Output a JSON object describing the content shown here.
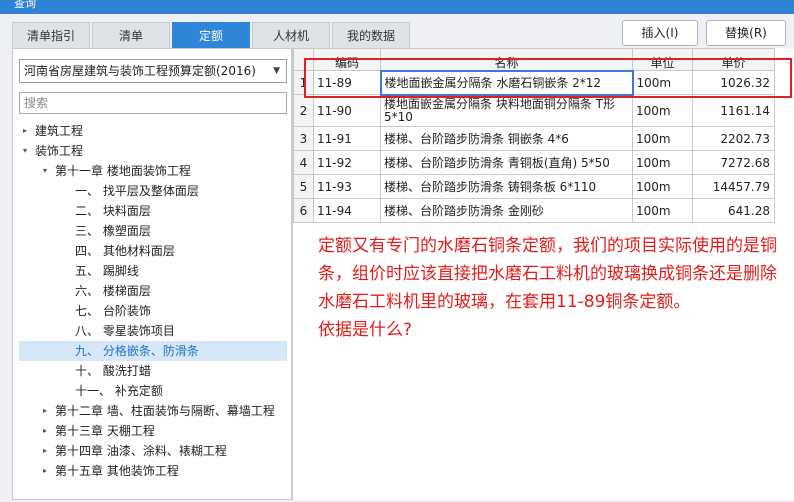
{
  "window": {
    "title": "查询"
  },
  "tabs": [
    {
      "label": "清单指引",
      "active": false
    },
    {
      "label": "清单",
      "active": false
    },
    {
      "label": "定额",
      "active": true
    },
    {
      "label": "人材机",
      "active": false
    },
    {
      "label": "我的数据",
      "active": false
    }
  ],
  "buttons": {
    "insert": "插入(I)",
    "replace": "替换(R)"
  },
  "left": {
    "dropdown_value": "河南省房屋建筑与装饰工程预算定额(2016)",
    "search_placeholder": "搜索",
    "tree": [
      {
        "label": "建筑工程",
        "arrow": "▸",
        "level": 0
      },
      {
        "label": "装饰工程",
        "arrow": "▾",
        "level": 0
      },
      {
        "label": "第十一章 楼地面装饰工程",
        "arrow": "▾",
        "level": 1
      },
      {
        "label": "一、 找平层及整体面层",
        "arrow": "",
        "level": 2
      },
      {
        "label": "二、 块料面层",
        "arrow": "",
        "level": 2
      },
      {
        "label": "三、 橡塑面层",
        "arrow": "",
        "level": 2
      },
      {
        "label": "四、 其他材料面层",
        "arrow": "",
        "level": 2
      },
      {
        "label": "五、 踢脚线",
        "arrow": "",
        "level": 2
      },
      {
        "label": "六、 楼梯面层",
        "arrow": "",
        "level": 2
      },
      {
        "label": "七、 台阶装饰",
        "arrow": "",
        "level": 2
      },
      {
        "label": "八、 零星装饰项目",
        "arrow": "",
        "level": 2
      },
      {
        "label": "九、 分格嵌条、防滑条",
        "arrow": "",
        "level": 2,
        "selected": true
      },
      {
        "label": "十、 酸洗打蜡",
        "arrow": "",
        "level": 2
      },
      {
        "label": "十一、 补充定额",
        "arrow": "",
        "level": 2
      },
      {
        "label": "第十二章 墙、柱面装饰与隔断、幕墙工程",
        "arrow": "▸",
        "level": 1
      },
      {
        "label": "第十三章 天棚工程",
        "arrow": "▸",
        "level": 1
      },
      {
        "label": "第十四章 油漆、涂料、裱糊工程",
        "arrow": "▸",
        "level": 1
      },
      {
        "label": "第十五章 其他装饰工程",
        "arrow": "▸",
        "level": 1
      }
    ]
  },
  "table": {
    "headers": [
      "",
      "编码",
      "名称",
      "单位",
      "单价"
    ],
    "rows": [
      {
        "num": "1",
        "code": "11-89",
        "name": "楼地面嵌金属分隔条 水磨石铜嵌条 2*12",
        "unit": "100m",
        "price": "1026.32"
      },
      {
        "num": "2",
        "code": "11-90",
        "name": "楼地面嵌金属分隔条 块料地面铜分隔条 T形5*10",
        "unit": "100m",
        "price": "1161.14"
      },
      {
        "num": "3",
        "code": "11-91",
        "name": "楼梯、台阶踏步防滑条 铜嵌条 4*6",
        "unit": "100m",
        "price": "2202.73"
      },
      {
        "num": "4",
        "code": "11-92",
        "name": "楼梯、台阶踏步防滑条 青铜板(直角) 5*50",
        "unit": "100m",
        "price": "7272.68"
      },
      {
        "num": "5",
        "code": "11-93",
        "name": "楼梯、台阶踏步防滑条 铸铜条板 6*110",
        "unit": "100m",
        "price": "14457.79"
      },
      {
        "num": "6",
        "code": "11-94",
        "name": "楼梯、台阶踏步防滑条 金刚砂",
        "unit": "100m",
        "price": "641.28"
      }
    ]
  },
  "annotation": {
    "text": "定额又有专门的水磨石铜条定额，我们的项目实际使用的是铜条，组价时应该直接把水磨石工料机的玻璃换成铜条还是删除水磨石工料机里的玻璃，在套用11-89铜条定额。",
    "text2": "依据是什么?",
    "color": "#e21b1b"
  }
}
